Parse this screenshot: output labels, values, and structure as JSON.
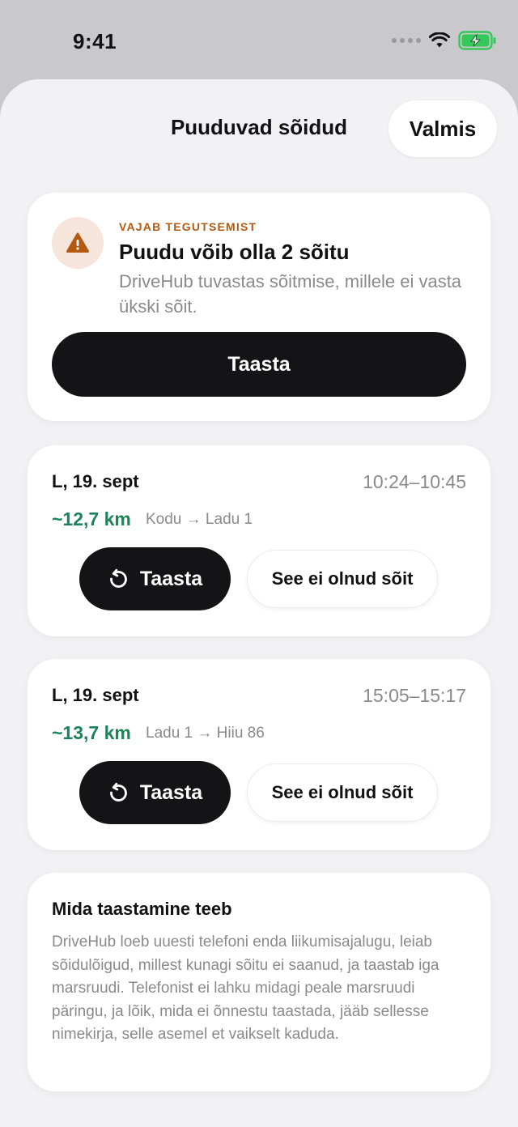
{
  "status_bar": {
    "time": "9:41"
  },
  "header": {
    "title": "Puuduvad sõidud",
    "done_label": "Valmis"
  },
  "alert": {
    "kicker": "VAJAB TEGUTSEMIST",
    "title": "Puudu võib olla 2 sõitu",
    "description": "DriveHub tuvastas sõitmise, millele ei vasta ükski sõit.",
    "button_label": "Taasta",
    "accent_color": "#b35a12"
  },
  "trips": [
    {
      "date": "L, 19. sept",
      "time_range": "10:24–10:45",
      "distance": "~12,7 km",
      "route": "Kodu → Ladu 1",
      "restore_label": "Taasta",
      "dismiss_label": "See ei olnud sõit"
    },
    {
      "date": "L, 19. sept",
      "time_range": "15:05–15:17",
      "distance": "~13,7 km",
      "route": "Ladu 1 → Hiiu 86",
      "restore_label": "Taasta",
      "dismiss_label": "See ei olnud sõit"
    }
  ],
  "info": {
    "title": "Mida taastamine teeb",
    "body": "DriveHub loeb uuesti telefoni enda liikumisajalugu, leiab sõidulõigud, millest kunagi sõitu ei saanud, ja taastab iga marsruudi. Telefonist ei lahku midagi peale marsruudi päringu, ja lõik, mida ei õnnestu taastada, jääb sellesse nimekirja, selle asemel et vaikselt kaduda."
  },
  "colors": {
    "distance": "#1b8458",
    "primary_button": "#141417",
    "battery": "#34c759"
  }
}
